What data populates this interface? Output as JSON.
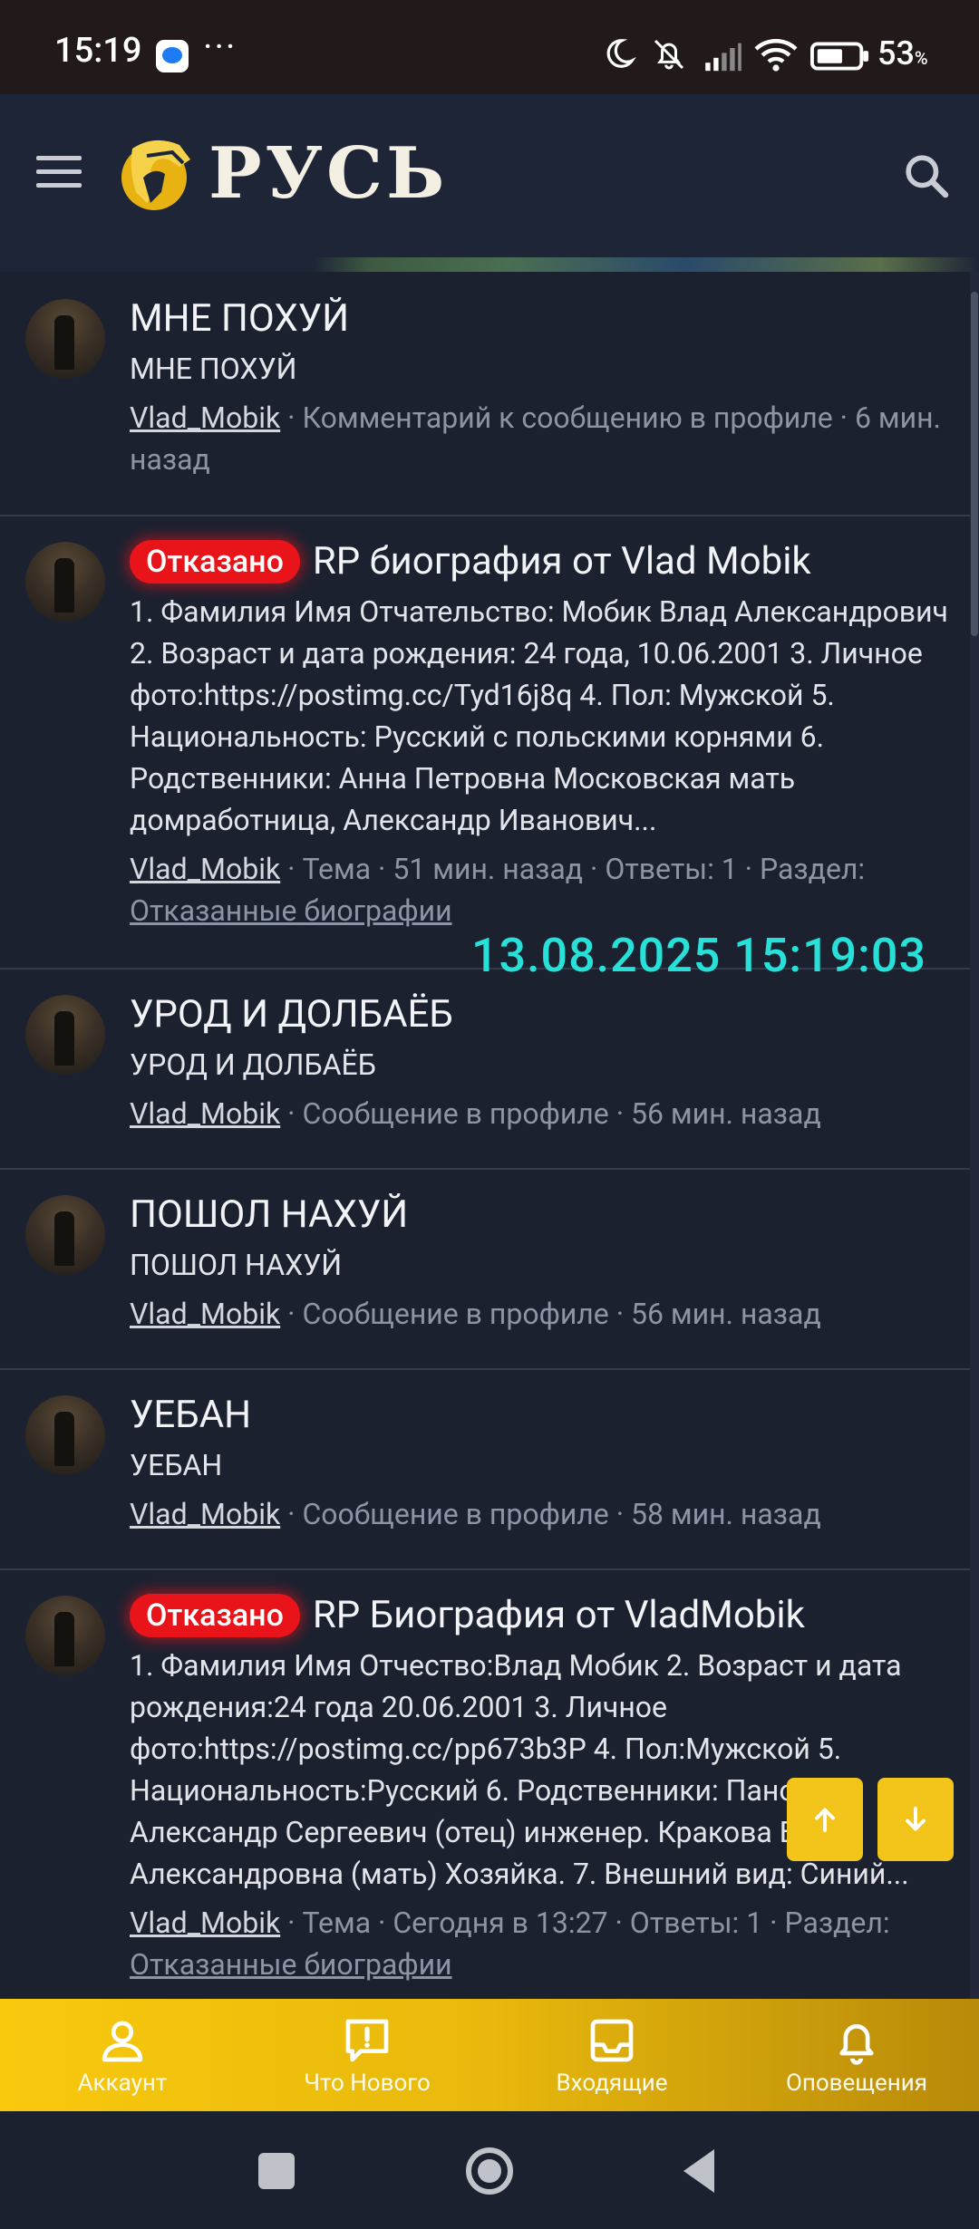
{
  "status_bar": {
    "time": "15:19",
    "more": "···",
    "battery_pct": "53",
    "battery_unit": "%"
  },
  "header": {
    "logo_text": "РУСЬ"
  },
  "overlay": {
    "timestamp": "13.08.2025 15:19:03"
  },
  "feed": [
    {
      "title": "МНЕ ПОХУЙ",
      "snippet": "МНЕ ПОХУЙ",
      "user": "Vlad_Mobik",
      "meta": " · Комментарий к сообщению в профиле · 6 мин. назад"
    },
    {
      "badge": "Отказано",
      "title": "RP биография от Vlad Mobik",
      "snippet": "1. Фамилия Имя Отчательство: Мобик Влад Александрович 2. Возраст и дата рождения: 24 года, 10.06.2001 3. Личное фото:https://postimg.cc/Tyd16j8q 4. Пол: Мужской 5. Национальность: Русский с польскими корнями 6. Родственники: Анна Петровна Московская мать домработница, Александр Иванович...",
      "user": "Vlad_Mobik",
      "meta": " · Тема · 51 мин. назад · Ответы: 1 · Раздел: ",
      "section": "Отказанные биографии"
    },
    {
      "title": "УРОД И ДОЛБАЁБ",
      "snippet": "УРОД И ДОЛБАЁБ",
      "user": "Vlad_Mobik",
      "meta": " · Сообщение в профиле · 56 мин. назад"
    },
    {
      "title": "ПОШОЛ НАХУЙ",
      "snippet": "ПОШОЛ НАХУЙ",
      "user": "Vlad_Mobik",
      "meta": " · Сообщение в профиле · 56 мин. назад"
    },
    {
      "title": "УЕБАН",
      "snippet": "УЕБАН",
      "user": "Vlad_Mobik",
      "meta": " · Сообщение в профиле · 58 мин. назад"
    },
    {
      "badge": "Отказано",
      "title": "RP Биография от VladMobik",
      "snippet": "1. Фамилия Имя Отчество:Влад Мобик 2. Возраст и дата рождения:24 года 20.06.2001 3. Личное фото:https://postimg.cc/pp673b3P 4. Пол:Мужской 5. Национальность:Русский 6. Родственники: Панов Александр Сергеевич (отец) инженер. Кракова Вера Александровна (мать) Хозяйка. 7. Внешний вид: Синий...",
      "user": "Vlad_Mobik",
      "meta": " · Тема · Сегодня в 13:27 · Ответы: 1 · Раздел: ",
      "section": "Отказанные биографии"
    }
  ],
  "bottom_nav": [
    {
      "label": "Аккаунт",
      "icon": "user-icon"
    },
    {
      "label": "Что Нового",
      "icon": "whats-new-icon"
    },
    {
      "label": "Входящие",
      "icon": "inbox-icon"
    },
    {
      "label": "Оповещения",
      "icon": "bell-icon"
    }
  ],
  "colors": {
    "accent": "#f3c51b",
    "badge_red": "#e8141a",
    "background": "#1c2130",
    "overlay_cyan": "#27e0d8"
  }
}
